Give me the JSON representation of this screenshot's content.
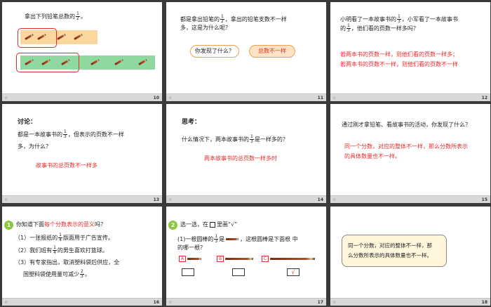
{
  "slides": {
    "s10": {
      "title_pre": "拿出下列铅笔总数的",
      "frac_num": "1",
      "frac_den": "2",
      "title_post": "。",
      "number": "10"
    },
    "s11": {
      "line1_pre": "都是拿出铅笔的",
      "frac_num": "1",
      "frac_den": "2",
      "line1_post": "，拿出的铅笔支数不一样",
      "line2": "多，这是为什么呢？",
      "bubble_left": "你发现了什么？",
      "bubble_right": "总数不一样",
      "number": "11"
    },
    "s12": {
      "line1_pre": "小明看了一本故事书的",
      "frac_num": "1",
      "frac_den": "3",
      "line1_post": "，小军看了一本故事书",
      "line2_pre": "的",
      "line2_post": "，他们看的页数一样多吗？",
      "ans1": "若两本书的页数一样，则他们看的页数一样多；",
      "ans2": "若两本书的页数不一样，则他们看的页数不一样",
      "number": "12"
    },
    "s13": {
      "heading": "讨论：",
      "line1_pre": "都是一本故事书的",
      "frac_num": "1",
      "frac_den": "3",
      "line1_post": "，但表示的页数不一样",
      "line2": "多，为什么？",
      "answer": "故事书的总页数不一样多",
      "number": "13"
    },
    "s14": {
      "heading": "思考：",
      "line1_pre": "什么情况下，两本故事书的",
      "frac_num": "1",
      "frac_den": "3",
      "line1_post": "是一样多的？",
      "answer": "两本故事书的总页数一样多时",
      "number": "14"
    },
    "s15": {
      "question": "通过刚才拿铅笔、看故事书的活动，你发现了什么？",
      "ans1": "同一个分数，对应的整体不一样，那么分数所表示",
      "ans2": "的具体数量也不一样。",
      "number": "15"
    },
    "s16": {
      "badge": "1",
      "q_pre": "你知道下面",
      "q_red": "每个分数表示的意义",
      "q_post": "吗？",
      "i1_pre": "（1）一张报纸的",
      "i1_num": "1",
      "i1_den": "4",
      "i1_post": "版面用于广告宣传。",
      "i2_pre": "（2）我们班有",
      "i2_num": "1",
      "i2_den": "4",
      "i2_post": "的男生喜欢打篮球。",
      "i3": "（3）有专家指出，取消塑料袋后供应，全",
      "i4_pre": "国塑料袋使用量可减少",
      "i4_num": "2",
      "i4_den": "3",
      "i4_post": "。",
      "number": "16"
    },
    "s17": {
      "badge": "2",
      "title_pre": "选一选，在",
      "title_post": "里画“√”",
      "q1_pre": "(1)一根圆棒的",
      "frac_num": "1",
      "frac_den": "3",
      "q1_mid": "是",
      "q1_post": "，这根圆棒是下面根  中",
      "q2": "的哪一根？",
      "opt_a": "A",
      "opt_b": "B",
      "opt_c": "C",
      "check": "√",
      "number": "17"
    },
    "s18": {
      "line1": "同一个分数，对应的整体不一样，那",
      "line2": "么分数所表示的具体数量也不一样。",
      "number": "18"
    }
  },
  "colors": {
    "accent_red": "#e52a2a",
    "pencil_box_orange": "#fbd79f",
    "pencil_box_green": "#8fd9a0",
    "badge_green": "#8cc63f",
    "summary_box": "#fff6dc"
  }
}
